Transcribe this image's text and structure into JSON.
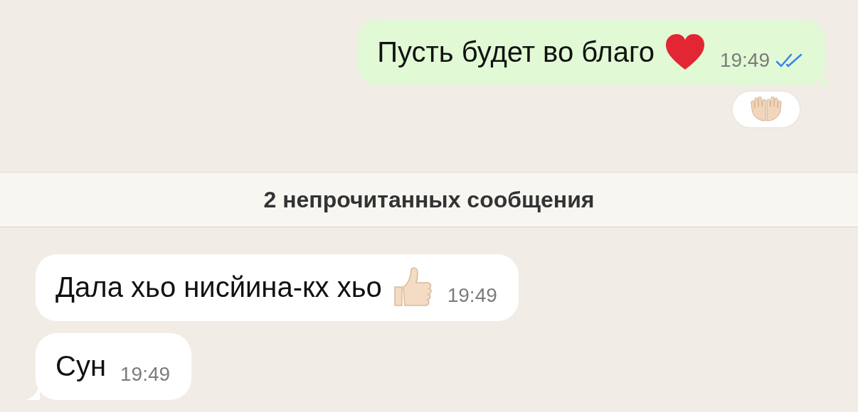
{
  "messages": [
    {
      "kind": "outgoing",
      "text": "Пусть будет во благо",
      "time": "19:49",
      "read": true,
      "reacted": true
    },
    {
      "kind": "banner",
      "text": "2 непрочитанных сообщения"
    },
    {
      "kind": "incoming",
      "text": "Дала хьо нисйина-кх хьо",
      "time": "19:49",
      "tail": false
    },
    {
      "kind": "incoming",
      "text": "Сун",
      "time": "19:49",
      "tail": true
    }
  ]
}
